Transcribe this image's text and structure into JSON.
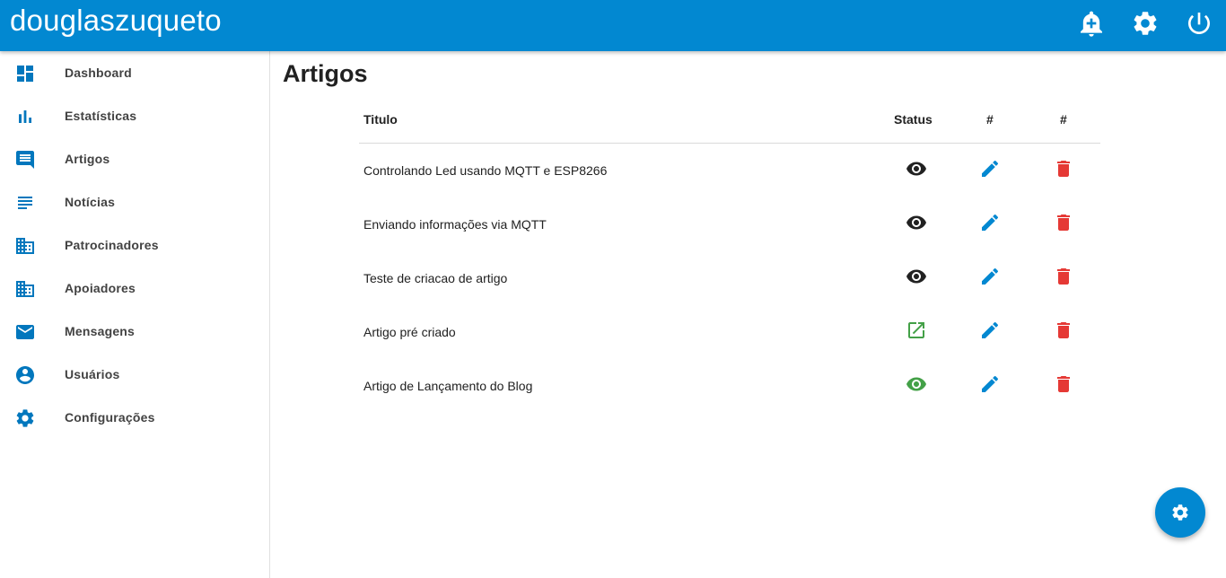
{
  "header": {
    "brand": "douglaszuqueto",
    "icons": [
      "add-alert-icon",
      "settings-icon",
      "power-icon"
    ],
    "color": "#0288d1"
  },
  "sidebar": {
    "items": [
      {
        "label": "Dashboard",
        "icon": "dashboard-icon"
      },
      {
        "label": "Estatísticas",
        "icon": "bar-chart-icon"
      },
      {
        "label": "Artigos",
        "icon": "comment-icon"
      },
      {
        "label": "Notícias",
        "icon": "subject-icon"
      },
      {
        "label": "Patrocinadores",
        "icon": "business-icon"
      },
      {
        "label": "Apoiadores",
        "icon": "business-icon"
      },
      {
        "label": "Mensagens",
        "icon": "mail-icon"
      },
      {
        "label": "Usuários",
        "icon": "account-circle-icon"
      },
      {
        "label": "Configurações",
        "icon": "settings-icon"
      }
    ]
  },
  "main": {
    "title": "Artigos",
    "table": {
      "headers": [
        "Titulo",
        "Status",
        "#",
        "#"
      ],
      "rows": [
        {
          "title": "Controlando Led usando MQTT e ESP8266",
          "status_icon": "eye-icon",
          "status_color": "#212121"
        },
        {
          "title": "Enviando informações via MQTT",
          "status_icon": "eye-icon",
          "status_color": "#212121"
        },
        {
          "title": "Teste de criacao de artigo",
          "status_icon": "eye-icon",
          "status_color": "#212121"
        },
        {
          "title": "Artigo pré criado",
          "status_icon": "open-in-new-icon",
          "status_color": "#43a047"
        },
        {
          "title": "Artigo de Lançamento do Blog",
          "status_icon": "eye-icon",
          "status_color": "#43a047"
        }
      ],
      "edit_color": "#0288d1",
      "delete_color": "#e53935"
    }
  },
  "fab": {
    "icon": "settings-icon"
  }
}
